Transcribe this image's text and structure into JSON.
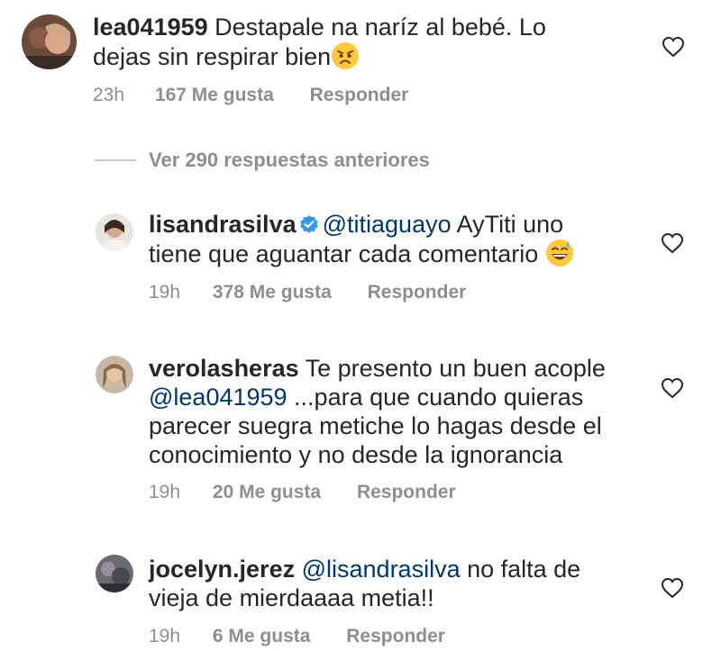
{
  "comments": [
    {
      "username": "lea041959",
      "text_lines": [
        "Destapale na naríz al bebé. Lo",
        "dejas sin respirar bien"
      ],
      "emoji": "angry-face",
      "time": "23h",
      "likes": "167 Me gusta",
      "reply_label": "Responder"
    },
    {
      "username": "lisandrasilva",
      "verified": true,
      "mention": "@titiaguayo",
      "text_line1_rest": "AyTiti uno",
      "text_line2": "tiene que aguantar cada comentario",
      "emoji": "grinning-sweat-face",
      "time": "19h",
      "likes": "378 Me gusta",
      "reply_label": "Responder"
    },
    {
      "username": "verolasheras",
      "text_line1_rest": "Te presento un buen acople",
      "mention": "@lea041959",
      "text_line2_rest": " ...para que cuando quieras",
      "text_line3": "parecer suegra metiche lo hagas desde el",
      "text_line4": "conocimiento y no desde la ignorancia",
      "time": "19h",
      "likes": "20 Me gusta",
      "reply_label": "Responder"
    },
    {
      "username": "jocelyn.jerez",
      "mention": "@lisandrasilva",
      "text_line1_rest": " no falta de",
      "text_line2": "vieja de mierdaaaa metia!!",
      "time": "19h",
      "likes": "6 Me gusta",
      "reply_label": "Responder"
    }
  ],
  "view_more_replies": "Ver 290 respuestas anteriores",
  "colors": {
    "text": "#262626",
    "secondary": "#8e8e8e",
    "mention": "#00376b",
    "verified": "#3897f0"
  }
}
